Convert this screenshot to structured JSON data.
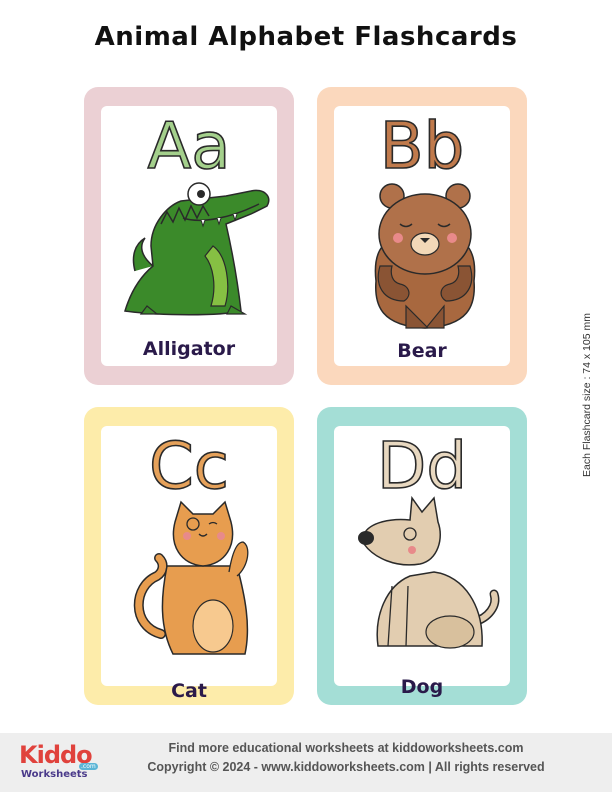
{
  "title": "Animal Alphabet Flashcards",
  "side_note": "Each Flashcard size : 74 x 105 mm",
  "colors": {
    "pink": "#ebd0d4",
    "peach": "#fbd8bd",
    "yellow": "#fdecaa",
    "teal": "#a4ded6",
    "letter_a": "#a4d08c",
    "letter_b": "#c07a4c",
    "letter_c": "#e5a15a",
    "letter_d": "#e8d8c0"
  },
  "cards": [
    {
      "letters": "Aa",
      "word": "Alligator"
    },
    {
      "letters": "Bb",
      "word": "Bear"
    },
    {
      "letters": "Cc",
      "word": "Cat"
    },
    {
      "letters": "Dd",
      "word": "Dog"
    }
  ],
  "footer": {
    "line1": "Find more educational worksheets at kiddoworksheets.com",
    "line2": "Copyright © 2024 - www.kiddoworksheets.com  |  All rights reserved",
    "logo_kiddo": "Kiddo",
    "logo_worksheets": "Worksheets",
    "logo_com": ".com"
  }
}
